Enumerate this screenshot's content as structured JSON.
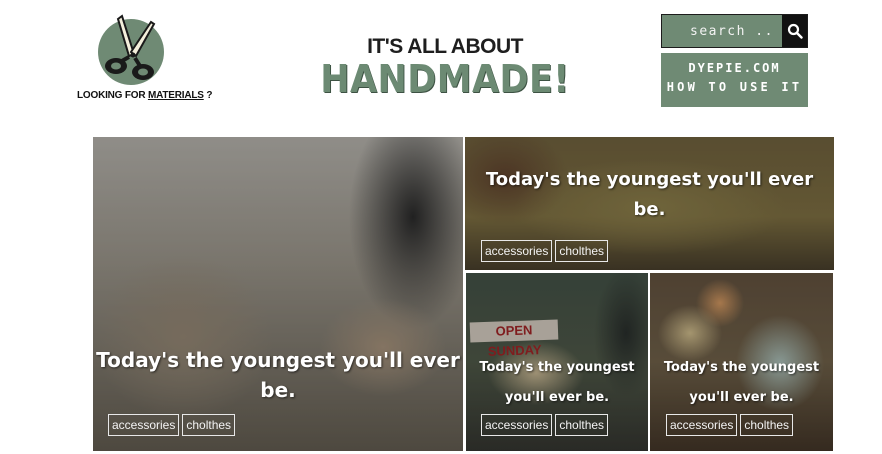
{
  "header": {
    "logo_caption_prefix": "LOOKING FOR ",
    "logo_caption_link": "MATERIALS",
    "logo_caption_suffix": " ?",
    "tagline_small": "IT'S ALL ABOUT",
    "tagline_big": "HANDMADE!"
  },
  "search": {
    "placeholder": "search .."
  },
  "ad": {
    "line1": "DYEPIE.COM",
    "line2": "HOW TO USE IT"
  },
  "colors": {
    "brand_green": "#6f8a74",
    "tagline_green": "#6c8a73"
  },
  "tiles": [
    {
      "headline_line1": "Today's the youngest you'll ever",
      "headline_line2": "be.",
      "tags": [
        "accessories",
        "cholthes"
      ]
    },
    {
      "headline_line1": "Today's the youngest you'll ever",
      "headline_line2": "be.",
      "tags": [
        "accessories",
        "cholthes"
      ]
    },
    {
      "sign_text": "OPEN SUNDAY",
      "headline_line1": "Today's the youngest",
      "headline_line2": "you'll ever be.",
      "tags": [
        "accessories",
        "cholthes"
      ]
    },
    {
      "headline_line1": "Today's the youngest",
      "headline_line2": "you'll ever be.",
      "tags": [
        "accessories",
        "cholthes"
      ]
    }
  ]
}
